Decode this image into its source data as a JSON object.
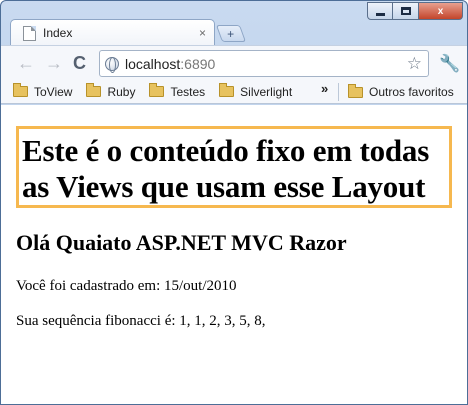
{
  "browser": {
    "tab": {
      "title": "Index",
      "close_glyph": "×"
    },
    "new_tab_glyph": "+",
    "window_controls": {
      "minimize": "",
      "maximize": "",
      "close": "x"
    },
    "toolbar": {
      "back_icon": "←",
      "forward_icon": "→",
      "reload_icon": "C",
      "address": {
        "host": "localhost",
        "port": ":6890"
      },
      "star_icon": "☆",
      "wrench_icon": "🔧"
    },
    "bookmarks": {
      "items": [
        {
          "label": "ToView"
        },
        {
          "label": "Ruby"
        },
        {
          "label": "Testes"
        },
        {
          "label": "Silverlight"
        }
      ],
      "overflow_glyph": "»",
      "other": "Outros favoritos"
    }
  },
  "page": {
    "fixed_content": "Este é o conteúdo fixo em todas as Views que usam esse Layout",
    "greeting": "Olá Quaiato ASP.NET MVC Razor",
    "registered": "Você foi cadastrado em: 15/out/2010",
    "fibonacci": "Sua sequência fibonacci é: 1, 1, 2, 3, 5, 8,"
  },
  "colors": {
    "fixed_box_border": "#f6b84f",
    "frame": "#a9c2e3"
  }
}
